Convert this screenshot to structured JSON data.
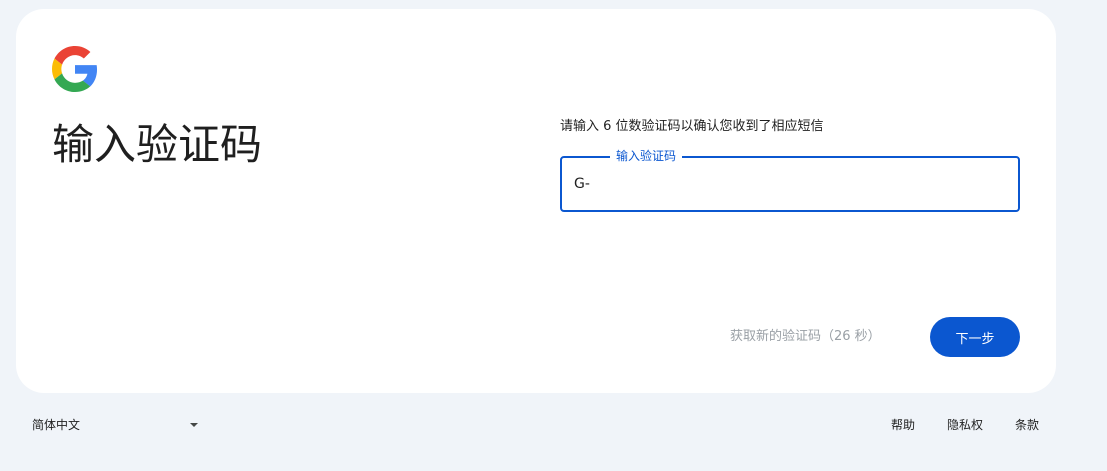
{
  "card": {
    "title": "输入验证码",
    "instruction": "请输入 6 位数验证码以确认您收到了相应短信",
    "code_field": {
      "label": "输入验证码",
      "value": "G-"
    },
    "resend_text": "获取新的验证码（26 秒）",
    "next_label": "下一步"
  },
  "footer": {
    "language": "简体中文",
    "links": [
      "帮助",
      "隐私权",
      "条款"
    ]
  },
  "colors": {
    "accent": "#0b57d0",
    "page_background": "#f0f4f9",
    "card_background": "#ffffff",
    "muted_text": "#9aa0a6"
  },
  "icons": {
    "logo": "google-logo-icon",
    "language_dropdown": "caret-down-icon"
  }
}
